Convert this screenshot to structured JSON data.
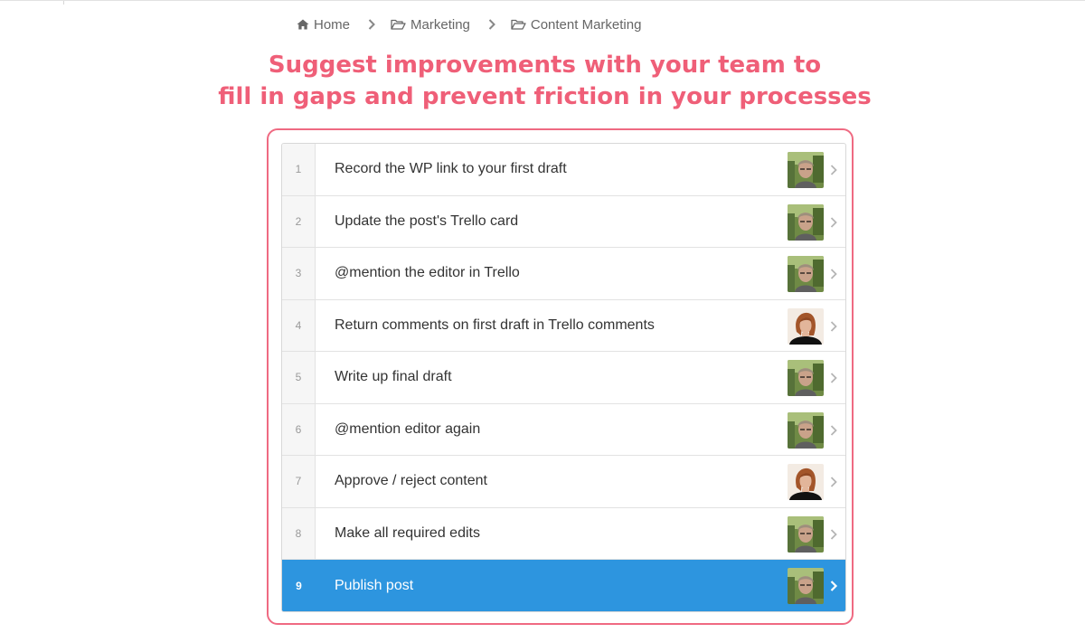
{
  "breadcrumb": {
    "items": [
      {
        "label": "Home",
        "icon": "home-icon"
      },
      {
        "label": "Marketing",
        "icon": "folder-icon"
      },
      {
        "label": "Content Marketing",
        "icon": "folder-icon"
      }
    ],
    "separator_icon": "chevron-right-icon"
  },
  "headline": {
    "line1": "Suggest improvements with your team to",
    "line2": "fill in gaps and prevent friction in your processes"
  },
  "colors": {
    "headline": "#ef5f78",
    "frame": "#ef6a82",
    "active_row": "#2d95df"
  },
  "checklist": {
    "active_index": 9,
    "items": [
      {
        "number": "1",
        "label": "Record the WP link to your first draft",
        "assignee_avatar": "assignee-man-avatar"
      },
      {
        "number": "2",
        "label": "Update the post's Trello card",
        "assignee_avatar": "assignee-man-avatar"
      },
      {
        "number": "3",
        "label": "@mention the editor in Trello",
        "assignee_avatar": "assignee-man-avatar"
      },
      {
        "number": "4",
        "label": "Return comments on first draft in Trello comments",
        "assignee_avatar": "assignee-woman-avatar"
      },
      {
        "number": "5",
        "label": "Write up final draft",
        "assignee_avatar": "assignee-man-avatar"
      },
      {
        "number": "6",
        "label": "@mention editor again",
        "assignee_avatar": "assignee-man-avatar"
      },
      {
        "number": "7",
        "label": "Approve / reject content",
        "assignee_avatar": "assignee-woman-avatar"
      },
      {
        "number": "8",
        "label": "Make all required edits",
        "assignee_avatar": "assignee-man-avatar"
      },
      {
        "number": "9",
        "label": "Publish post",
        "assignee_avatar": "assignee-man-avatar"
      }
    ]
  }
}
